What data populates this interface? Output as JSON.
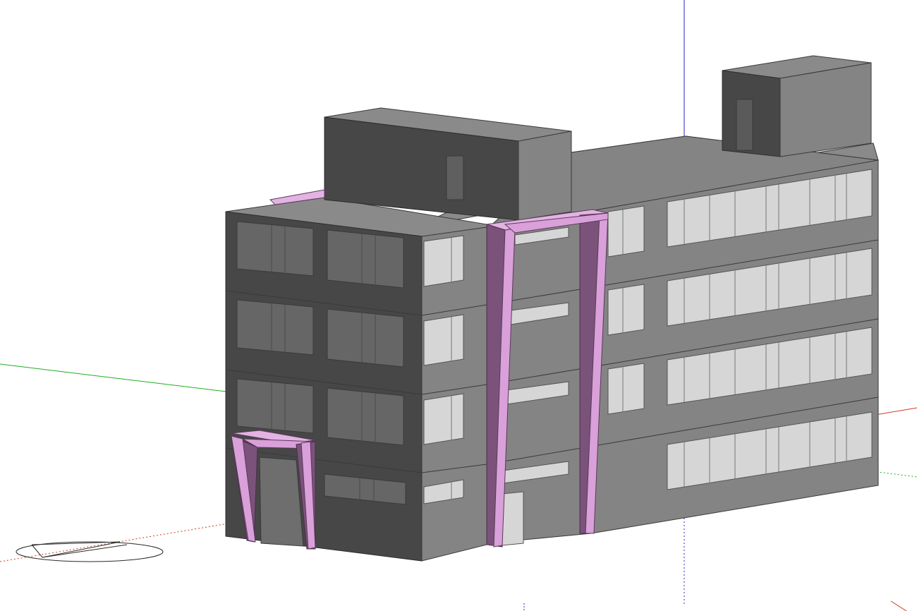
{
  "viewport": {
    "background": "#ffffff",
    "axes": {
      "red": "#cc3a1a",
      "green": "#1fae1f",
      "blue": "#2626c8"
    }
  },
  "model": {
    "wall_dark": "#474747",
    "wall_mid": "#848484",
    "glass": "#d6d6d6",
    "accent": "#d9a0d9",
    "accent_shadow": "#7a527a"
  }
}
